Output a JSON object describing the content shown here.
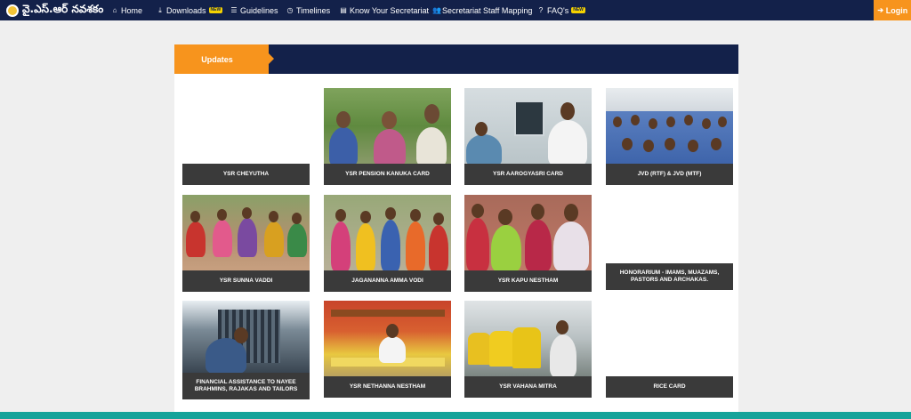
{
  "brand": {
    "title": "వై.ఎస్.ఆర్ నవశకం"
  },
  "nav": {
    "items": [
      {
        "label": "Home",
        "icon": "home-icon",
        "badge": ""
      },
      {
        "label": "Downloads",
        "icon": "download-icon",
        "badge": "NEW"
      },
      {
        "label": "Guidelines",
        "icon": "list-icon",
        "badge": ""
      },
      {
        "label": "Timelines",
        "icon": "clock-icon",
        "badge": ""
      },
      {
        "label": "Know Your Secretariat",
        "icon": "document-icon",
        "badge": ""
      },
      {
        "label": "Secretariat Staff Mapping",
        "icon": "users-icon",
        "badge": ""
      },
      {
        "label": "FAQ's",
        "icon": "question-icon",
        "badge": "NEW"
      }
    ],
    "login_label": "Login"
  },
  "updates": {
    "tab_label": "Updates"
  },
  "cards": [
    {
      "label": "YSR CHEYUTHA"
    },
    {
      "label": "YSR PENSION KANUKA CARD"
    },
    {
      "label": "YSR AAROGYASRI CARD"
    },
    {
      "label": "JVD (RTF) & JVD (MTF)"
    },
    {
      "label": "YSR SUNNA VADDI"
    },
    {
      "label": "JAGANANNA AMMA VODI"
    },
    {
      "label": "YSR KAPU NESTHAM"
    },
    {
      "label": "HONORARIUM - IMAMS, MUAZAMS, PASTORS AND ARCHAKAS."
    },
    {
      "label": "FINANCIAL ASSISTANCE TO NAYEE BRAHMINS, RAJAKAS AND TAILORS"
    },
    {
      "label": "YSR NETHANNA NESTHAM"
    },
    {
      "label": "YSR VAHANA MITRA"
    },
    {
      "label": "RICE CARD"
    }
  ],
  "colors": {
    "navbar": "#13214a",
    "accent": "#f7941d",
    "label_bg": "#3a3a3a",
    "footer": "#15a39a"
  }
}
